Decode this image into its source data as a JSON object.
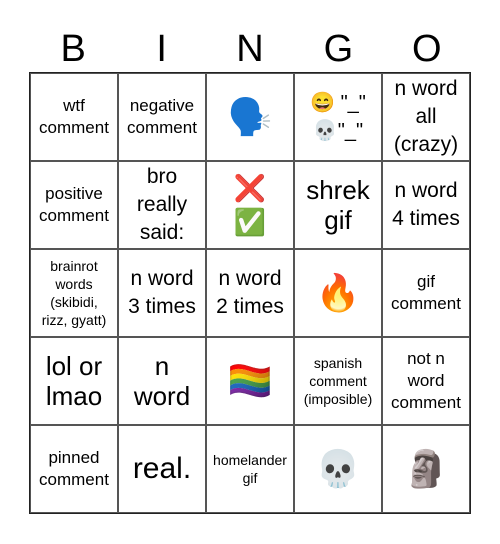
{
  "header": [
    "B",
    "I",
    "N",
    "G",
    "O"
  ],
  "cells": [
    {
      "text": "wtf\ncomment",
      "size": "s-md"
    },
    {
      "text": "negative\ncomment",
      "size": "s-md"
    },
    {
      "text": "🗣️",
      "size": "s-emoji"
    },
    {
      "text": "😄 \"_\"\n💀\"_\"",
      "size": "s-mixed"
    },
    {
      "text": "n word\nall\n(crazy)",
      "size": "s-lg"
    },
    {
      "text": "positive\ncomment",
      "size": "s-md"
    },
    {
      "text": "bro\nreally\nsaid:",
      "size": "s-lg"
    },
    {
      "text": "❌\n✅",
      "size": "s-emoji2"
    },
    {
      "text": "shrek\ngif",
      "size": "s-xl"
    },
    {
      "text": "n word\n4 times",
      "size": "s-lg"
    },
    {
      "text": "brainrot\nwords\n(skibidi,\nrizz, gyatt)",
      "size": "s-sm"
    },
    {
      "text": "n word\n3 times",
      "size": "s-lg"
    },
    {
      "text": "n word\n2 times",
      "size": "s-lg"
    },
    {
      "text": "🔥",
      "size": "s-emoji"
    },
    {
      "text": "gif\ncomment",
      "size": "s-md"
    },
    {
      "text": "lol or\nlmao",
      "size": "s-xl"
    },
    {
      "text": "n\nword",
      "size": "s-xl"
    },
    {
      "text": "🏳️‍🌈",
      "size": "s-emoji"
    },
    {
      "text": "spanish\ncomment\n(imposible)",
      "size": "s-sm"
    },
    {
      "text": "not n\nword\ncomment",
      "size": "s-md"
    },
    {
      "text": "pinned\ncomment",
      "size": "s-md"
    },
    {
      "text": "real.",
      "size": "s-xxl"
    },
    {
      "text": "homelander\ngif",
      "size": "s-sm"
    },
    {
      "text": "💀",
      "size": "s-emoji"
    },
    {
      "text": "🗿",
      "size": "s-emoji"
    }
  ]
}
